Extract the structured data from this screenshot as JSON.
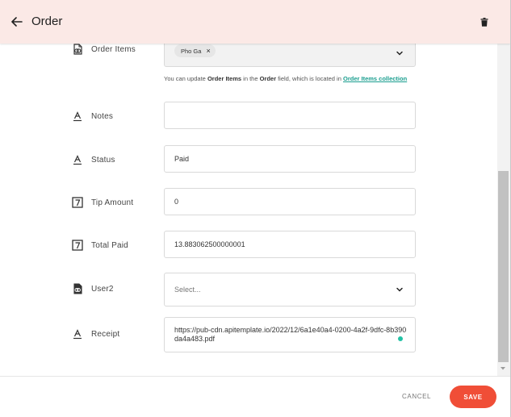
{
  "header": {
    "title": "Order",
    "back_icon": "arrow-left-icon",
    "delete_icon": "trash-icon"
  },
  "fields": {
    "order_items": {
      "label": "Order Items",
      "icon": "relation-doc-icon",
      "chips": [
        "Pho Ga"
      ],
      "chip_remove": "×",
      "helper_prefix": "You can update ",
      "helper_bold1": "Order Items",
      "helper_mid": " in the ",
      "helper_bold2": "Order",
      "helper_suffix": " field, which is located in ",
      "helper_link": "Order Items collection"
    },
    "notes": {
      "label": "Notes",
      "icon": "text-icon",
      "value": ""
    },
    "status": {
      "label": "Status",
      "icon": "text-icon",
      "value": "Paid"
    },
    "tip_amount": {
      "label": "Tip Amount",
      "icon": "number-icon",
      "value": "0"
    },
    "total_paid": {
      "label": "Total Paid",
      "icon": "number-icon",
      "value": "13.883062500000001"
    },
    "user2": {
      "label": "User2",
      "icon": "relation-link-icon",
      "placeholder": "Select..."
    },
    "receipt": {
      "label": "Receipt",
      "icon": "text-icon",
      "value": "https://pub-cdn.apitemplate.io/2022/12/6a1e40a4-0200-4a2f-9dfc-8b390da4a483.pdf"
    }
  },
  "footer": {
    "cancel_label": "CANCEL",
    "save_label": "SAVE"
  },
  "colors": {
    "header_bg": "#fbe9e6",
    "accent": "#f04e37",
    "link": "#1a9e8f",
    "status_dot": "#22c2a5"
  }
}
